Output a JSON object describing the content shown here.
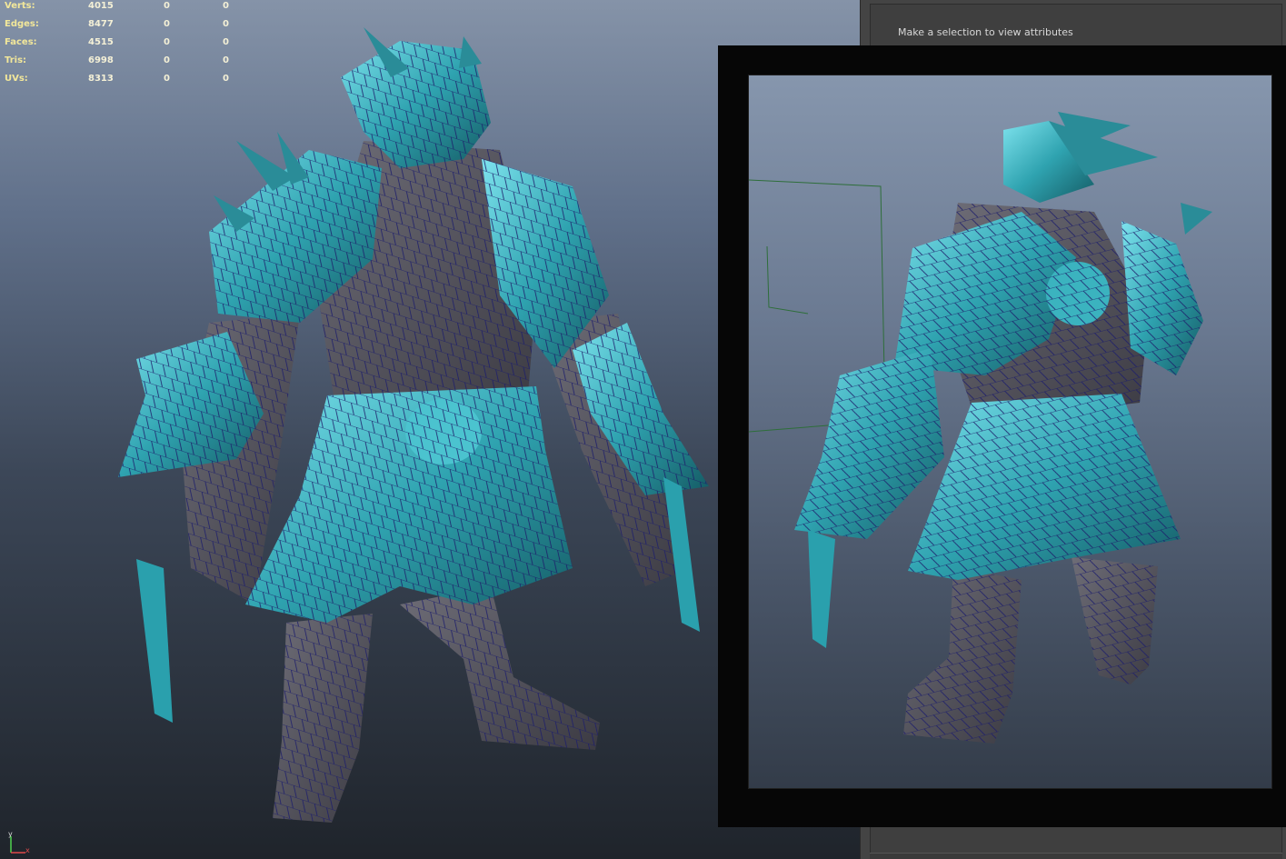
{
  "hud": {
    "stats": [
      {
        "label": "Verts:",
        "v1": "4015",
        "v2": "0",
        "v3": "0"
      },
      {
        "label": "Edges:",
        "v1": "8477",
        "v2": "0",
        "v3": "0"
      },
      {
        "label": "Faces:",
        "v1": "4515",
        "v2": "0",
        "v3": "0"
      },
      {
        "label": "Tris:",
        "v1": "6998",
        "v2": "0",
        "v3": "0"
      },
      {
        "label": "UVs:",
        "v1": "8313",
        "v2": "0",
        "v3": "0"
      }
    ]
  },
  "attribute_editor": {
    "message": "Make a selection to view attributes"
  },
  "axis": {
    "x": "x",
    "y": "y"
  },
  "colors": {
    "armor": "#2f9eab",
    "armor_highlight": "#6fd8e6",
    "skin": "#5e5d66",
    "wire": "#1d1e6b",
    "hud_label": "#f2e79a"
  },
  "icons": [
    "axis-gizmo-icon"
  ]
}
